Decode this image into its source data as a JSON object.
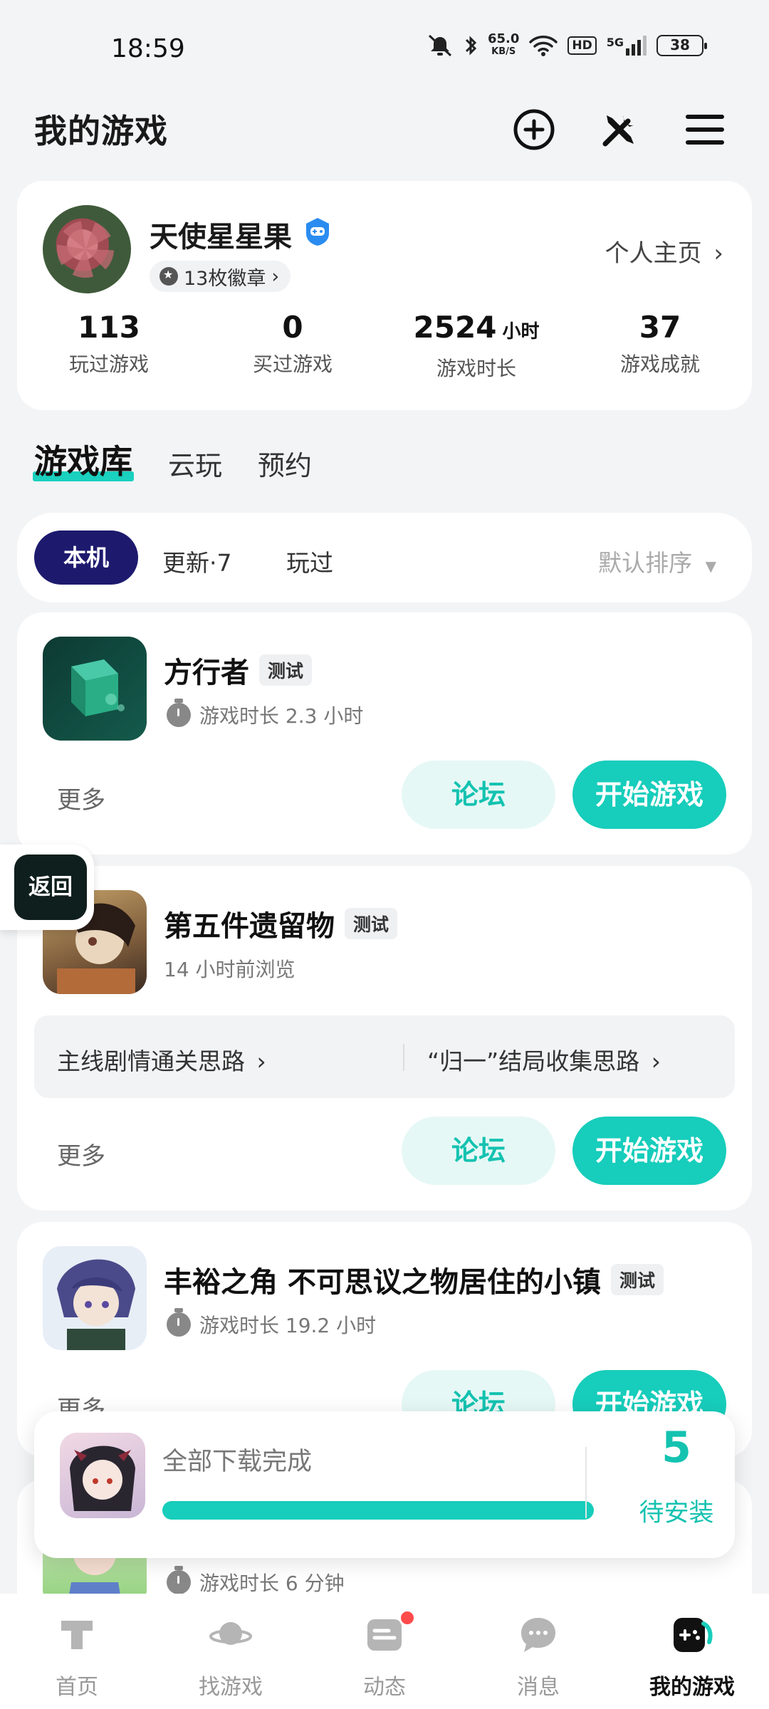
{
  "status_bar": {
    "time": "18:59",
    "net_speed_value": "65.0",
    "net_speed_unit": "KB/S",
    "hd": "HD",
    "signal": "5G",
    "battery": "38"
  },
  "header": {
    "title": "我的游戏",
    "icons": [
      "add-icon",
      "tools-icon",
      "menu-icon"
    ]
  },
  "profile": {
    "username": "天使星星果",
    "badges": "13枚徽章",
    "profile_link": "个人主页",
    "stats": [
      {
        "value": "113",
        "unit": "",
        "label": "玩过游戏"
      },
      {
        "value": "0",
        "unit": "",
        "label": "买过游戏"
      },
      {
        "value": "2524",
        "unit": "小时",
        "label": "游戏时长"
      },
      {
        "value": "37",
        "unit": "",
        "label": "游戏成就"
      }
    ]
  },
  "tabs": [
    "游戏库",
    "云玩",
    "预约"
  ],
  "filters": {
    "active": "本机",
    "update": "更新·7",
    "played": "玩过",
    "sort": "默认排序"
  },
  "games": [
    {
      "title": "方行者",
      "tag": "测试",
      "subtitle": "游戏时长 2.3 小时",
      "more": "更多",
      "forum": "论坛",
      "play": "开始游戏"
    },
    {
      "title": "第五件遗留物",
      "tag": "测试",
      "subtitle": "14 小时前浏览",
      "guide_left": "主线剧情通关思路",
      "guide_right": "“归一”结局收集思路",
      "more": "更多",
      "forum": "论坛",
      "play": "开始游戏"
    },
    {
      "title": "丰裕之角 不可思议之物居住的小镇",
      "tag": "测试",
      "subtitle": "游戏时长 19.2 小时",
      "more": "更多",
      "forum": "论坛",
      "play": "开始游戏"
    },
    {
      "subtitle": "游戏时长 6 分钟"
    }
  ],
  "return_button": "返回",
  "download": {
    "text": "全部下载完成",
    "progress": 1.0,
    "count": "5",
    "label": "待安装"
  },
  "bottom_nav": [
    {
      "label": "首页",
      "icon": "home-icon"
    },
    {
      "label": "找游戏",
      "icon": "planet-icon"
    },
    {
      "label": "动态",
      "icon": "feed-icon"
    },
    {
      "label": "消息",
      "icon": "message-icon"
    },
    {
      "label": "我的游戏",
      "icon": "gamepad-icon"
    }
  ],
  "colors": {
    "accent": "#17cdbb",
    "active_filter": "#1d1a6e",
    "badge_dot": "#ff4b4b"
  }
}
